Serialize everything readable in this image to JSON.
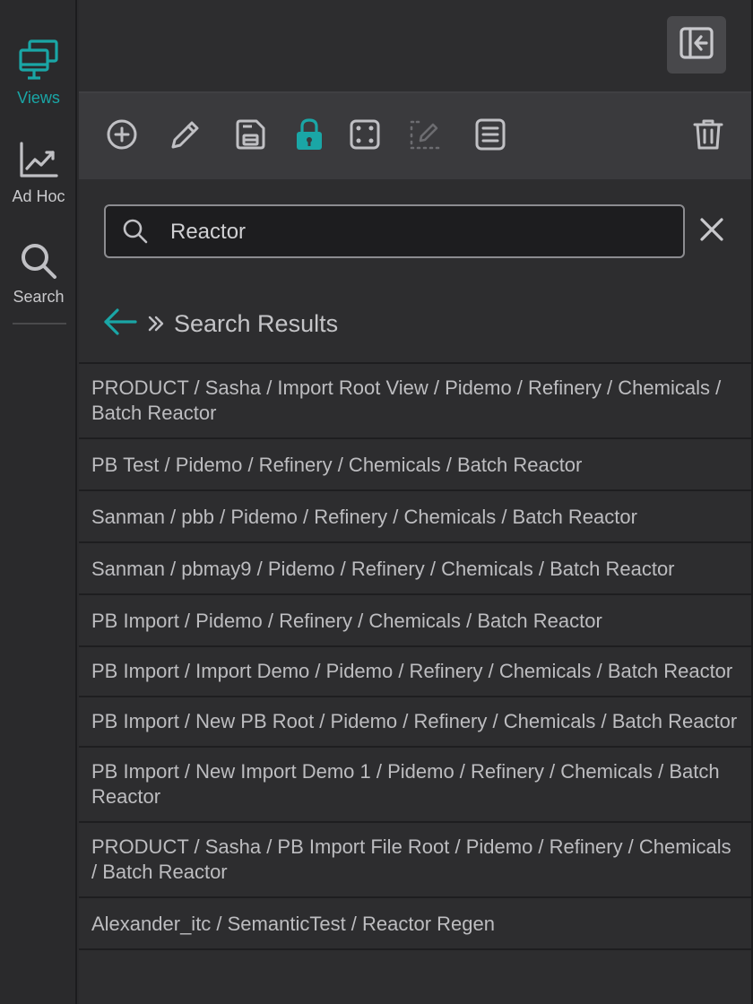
{
  "nav": {
    "items": [
      {
        "label": "Views",
        "icon": "monitors-icon",
        "active": true
      },
      {
        "label": "Ad Hoc",
        "icon": "trend-chart-icon",
        "active": false
      },
      {
        "label": "Search",
        "icon": "search-icon",
        "active": false
      }
    ]
  },
  "toolbar": {
    "buttons": [
      "add-icon",
      "edit-icon",
      "save-icon",
      "lock-icon",
      "dice-icon",
      "edit-area-icon",
      "list-icon",
      "trash-icon"
    ]
  },
  "search": {
    "value": "Reactor",
    "placeholder": ""
  },
  "breadcrumb": {
    "title": "Search Results"
  },
  "results": [
    "PRODUCT / Sasha / Import Root View / Pidemo / Refinery / Chemicals / Batch Reactor",
    "PB Test / Pidemo / Refinery / Chemicals / Batch Reactor",
    "Sanman / pbb / Pidemo / Refinery / Chemicals / Batch Reactor",
    "Sanman / pbmay9 / Pidemo / Refinery / Chemicals / Batch Reactor",
    "PB Import / Pidemo / Refinery / Chemicals / Batch Reactor",
    "PB Import / Import Demo / Pidemo / Refinery / Chemicals / Batch Reactor",
    "PB Import / New PB Root / Pidemo / Refinery / Chemicals / Batch Reactor",
    "PB Import / New Import Demo 1 / Pidemo / Refinery / Chemicals / Batch Reactor",
    "PRODUCT / Sasha / PB Import File Root / Pidemo / Refinery / Chemicals / Batch Reactor",
    "Alexander_itc / SemanticTest / Reactor Regen"
  ],
  "colors": {
    "accent": "#1aa6a6",
    "text": "#c9c9cc",
    "muted_icon": "#c0c0c4",
    "disabled_icon": "#6c6c70"
  }
}
